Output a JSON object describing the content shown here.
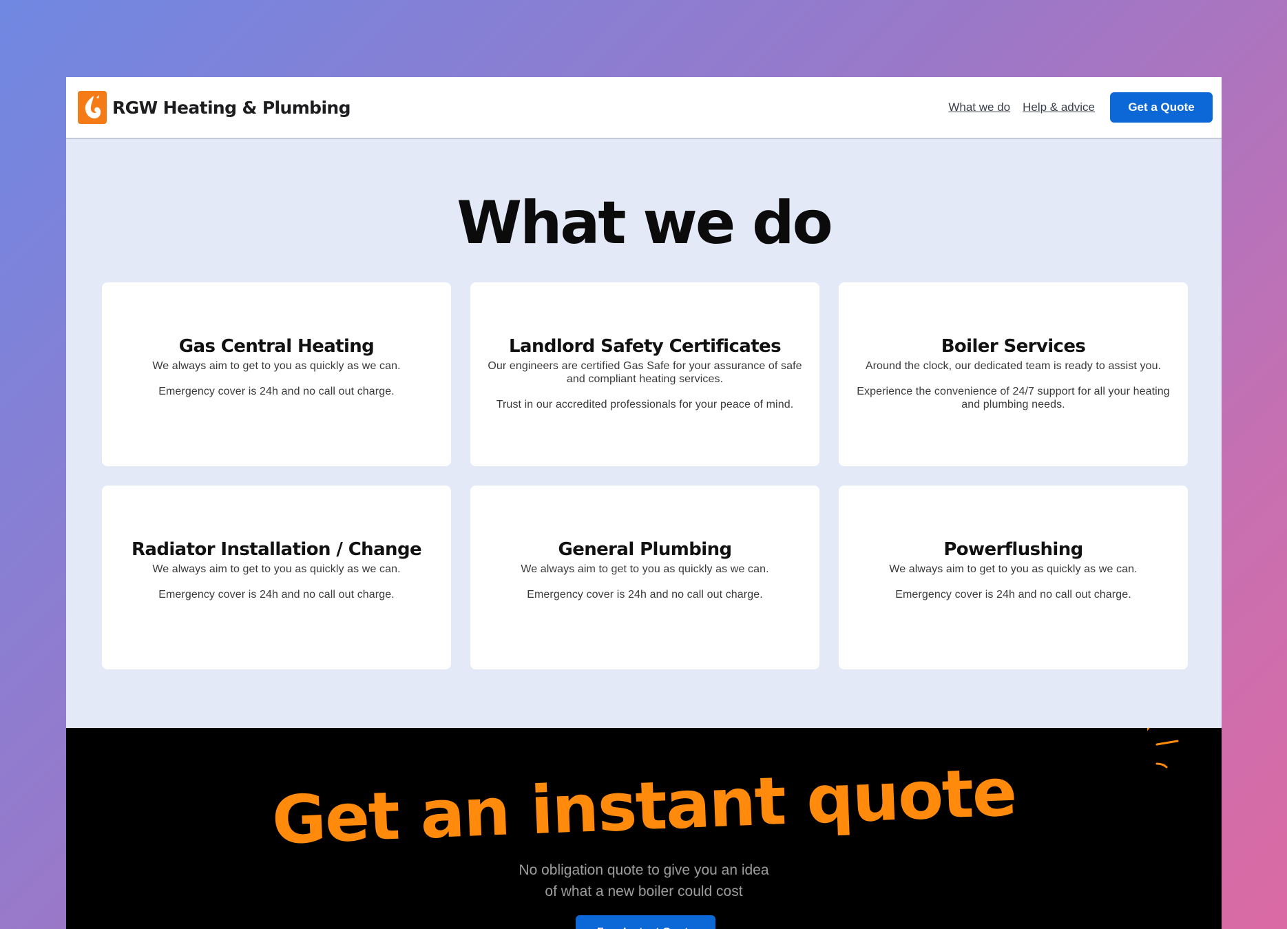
{
  "header": {
    "brand": "RGW Heating & Plumbing",
    "logo_icon": "flame-icon",
    "nav": [
      {
        "label": "What we do"
      },
      {
        "label": "Help & advice"
      }
    ],
    "cta_label": "Get a Quote"
  },
  "services": {
    "title": "What we do",
    "cards": [
      {
        "title": "Gas Central Heating",
        "p1": "We always aim to get to you as quickly as we can.",
        "p2": "Emergency cover is 24h and no call out charge."
      },
      {
        "title": "Landlord Safety Certificates",
        "p1": "Our engineers are certified Gas Safe for your assurance of safe and compliant heating services.",
        "p2": "Trust in our accredited professionals for your peace of mind."
      },
      {
        "title": "Boiler Services",
        "p1": "Around the clock, our dedicated team is ready to assist you.",
        "p2": "Experience the convenience of 24/7 support for all your heating and plumbing needs."
      },
      {
        "title": "Radiator Installation / Change",
        "p1": "We always aim to get to you as quickly as we can.",
        "p2": "Emergency cover is 24h and no call out charge."
      },
      {
        "title": "General Plumbing",
        "p1": "We always aim to get to you as quickly as we can.",
        "p2": "Emergency cover is 24h and no call out charge."
      },
      {
        "title": "Powerflushing",
        "p1": "We always aim to get to you as quickly as we can.",
        "p2": "Emergency cover is 24h and no call out charge."
      }
    ]
  },
  "quote": {
    "title": "Get an instant quote",
    "subtitle_line1": "No obligation quote to give you an idea",
    "subtitle_line2": "of what a new boiler could cost",
    "button_label": "Free Instant Quote"
  },
  "colors": {
    "accent": "#0b68d6",
    "brand_orange": "#f47b16",
    "quote_orange": "#ff8a0c",
    "section_bg": "#e4e9f7"
  }
}
